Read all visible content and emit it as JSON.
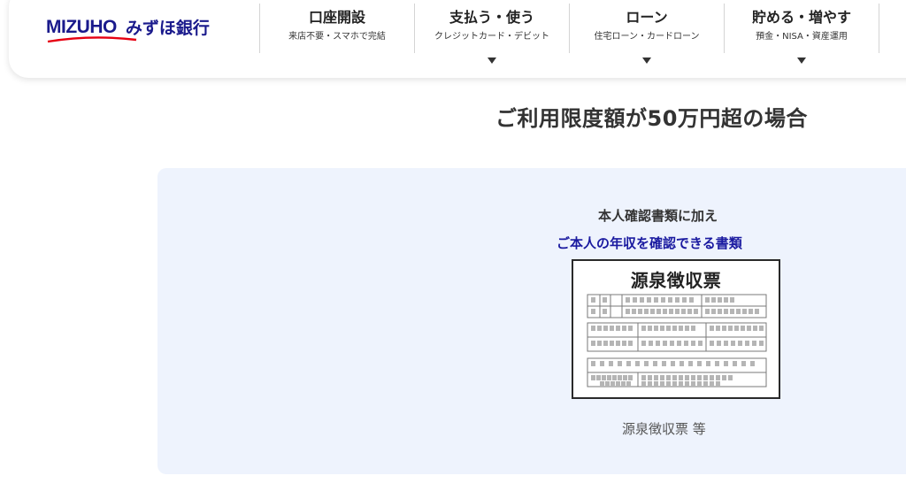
{
  "header": {
    "logo_en": "MIZUHO",
    "logo_jp": "みずほ銀行",
    "nav": [
      {
        "title": "口座開設",
        "sub": "来店不要・スマホで完結",
        "has_dropdown": false
      },
      {
        "title": "支払う・使う",
        "sub": "クレジットカード・デビット",
        "has_dropdown": true
      },
      {
        "title": "ローン",
        "sub": "住宅ローン・カードローン",
        "has_dropdown": true
      },
      {
        "title": "貯める・増やす",
        "sub": "預金・NISA・資産運用",
        "has_dropdown": true
      }
    ]
  },
  "main": {
    "heading": "ご利用限度額が50万円超の場合",
    "panel": {
      "intro": "本人確認書類に加え",
      "highlight": "ご本人の年収を確認できる書類",
      "illustration_title": "源泉徴収票",
      "caption": "源泉徴収票 等"
    }
  },
  "colors": {
    "brand_navy": "#1a1a8c",
    "brand_red": "#e60012",
    "highlight_blue": "#1a1aa0",
    "panel_bg": "#eef3fd"
  }
}
